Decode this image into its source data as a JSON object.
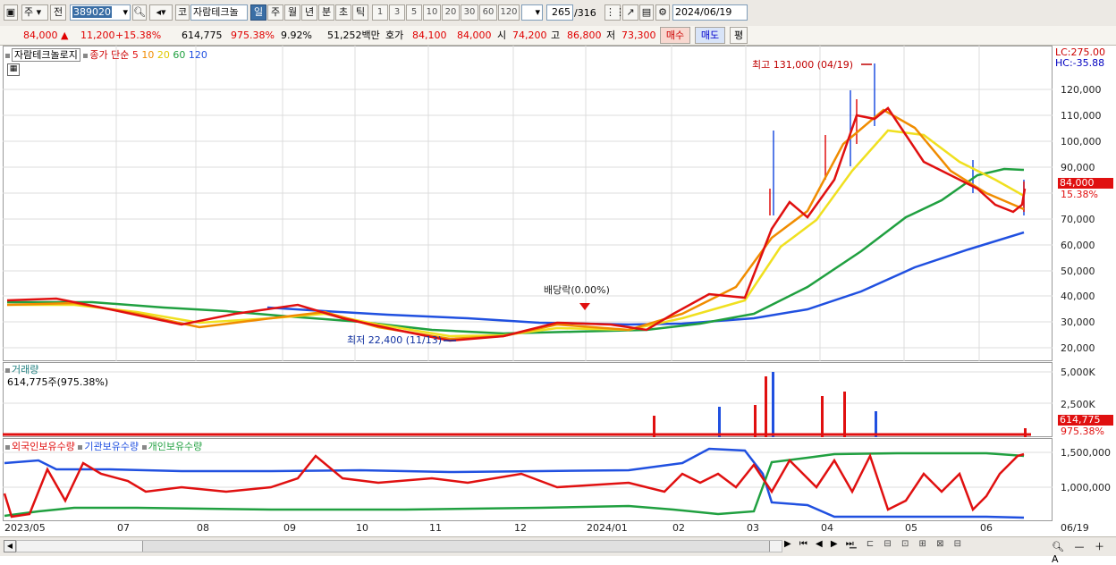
{
  "toolbar": {
    "market_label": "주",
    "prev_label": "전",
    "code_value": "389020",
    "name_badge": "코",
    "stock_name": "자람테크놀",
    "periods": [
      "일",
      "주",
      "월",
      "년",
      "분",
      "초",
      "틱"
    ],
    "selected_period": "일",
    "intervals": [
      "1",
      "3",
      "5",
      "10",
      "20",
      "30",
      "60",
      "120"
    ],
    "count_value": "265",
    "count_total": "/316",
    "date_value": "2024/06/19"
  },
  "quote": {
    "price": "84,000",
    "change": "11,200",
    "change_pct": "+15.38%",
    "volume": "614,775",
    "volume_ratio": "975.38%",
    "turnover": "9.92%",
    "amount": "51,252백만",
    "bid_label": "호가",
    "bid1": "84,100",
    "bid2": "84,000",
    "open_label": "시",
    "open": "74,200",
    "high_label": "고",
    "high": "86,800",
    "low_label": "저",
    "low": "73,300",
    "buy_label": "매수",
    "sell_label": "매도",
    "flat_label": "평"
  },
  "price_panel": {
    "title": "자람테크놀로지",
    "ma_label": "종가 단순",
    "ma_periods": [
      "5",
      "10",
      "20",
      "60",
      "120"
    ],
    "ma_colors": [
      "#e01010",
      "#f08c00",
      "#f0e020",
      "#20a040",
      "#2050e0"
    ],
    "lc_label": "LC:275.00",
    "hc_label": "HC:-35.88",
    "high_annotation": "최고 131,000 (04/19)",
    "low_annotation": "최저 22,400 (11/13)",
    "dividend_annotation": "배당락(0.00%)",
    "current_price_tag": "84,000",
    "current_pct_tag": "15.38%",
    "y_ticks": [
      "120,000",
      "110,000",
      "100,000",
      "90,000",
      "80,000",
      "70,000",
      "60,000",
      "50,000",
      "40,000",
      "30,000",
      "20,000"
    ]
  },
  "volume_panel": {
    "title": "거래량",
    "info": "614,775주(975.38%)",
    "y_ticks": [
      "5,000K",
      "2,500K"
    ],
    "value_tag": "614,775",
    "pct_tag": "975.38%"
  },
  "holding_panel": {
    "legend": [
      "외국인보유수량",
      "기관보유수량",
      "개인보유수량"
    ],
    "legend_colors": [
      "#e01010",
      "#2050e0",
      "#20a040"
    ],
    "y_ticks": [
      "1,500,000",
      "1,000,000"
    ]
  },
  "x_axis": [
    "2023/05",
    "07",
    "08",
    "09",
    "10",
    "11",
    "12",
    "2024/01",
    "02",
    "03",
    "04",
    "05",
    "06",
    "06/19"
  ],
  "chart_data": {
    "type": "line",
    "title": "자람테크놀로지",
    "x": [
      "2023/05",
      "07",
      "08",
      "09",
      "10",
      "11",
      "12",
      "2024/01",
      "02",
      "03",
      "04",
      "05",
      "06"
    ],
    "series": [
      {
        "name": "종가 (close)",
        "values": [
          37000,
          35000,
          30000,
          34000,
          31000,
          24000,
          25000,
          31000,
          29000,
          42000,
          95000,
          100000,
          78000
        ]
      },
      {
        "name": "120",
        "values": [
          null,
          null,
          null,
          34000,
          32000,
          31000,
          29000,
          28500,
          29000,
          31000,
          42000,
          55000,
          64000
        ]
      }
    ],
    "ylim": [
      15000,
      135000
    ],
    "annotations": [
      "최고 131,000 (04/19)",
      "최저 22,400 (11/13)",
      "배당락(0.00%)"
    ]
  }
}
